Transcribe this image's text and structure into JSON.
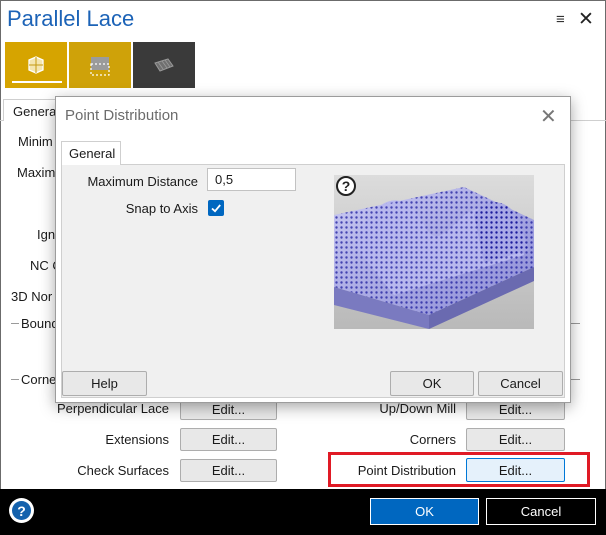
{
  "window": {
    "title": "Parallel Lace",
    "menu_glyph": "≡",
    "close_glyph": "✕"
  },
  "toolbar": {
    "tabs": [
      {
        "icon": "lace-surface-icon"
      },
      {
        "icon": "boundary-icon"
      },
      {
        "icon": "mesh-icon"
      }
    ]
  },
  "background": {
    "tab_label": "General",
    "labels": [
      "Minim",
      "Maxim",
      "Ign",
      "NC C",
      "3D Nor"
    ],
    "groups": [
      "Bound",
      "Corne"
    ],
    "rows_left": [
      {
        "label": "Perpendicular Lace",
        "button": "Edit..."
      },
      {
        "label": "Extensions",
        "button": "Edit..."
      },
      {
        "label": "Check Surfaces",
        "button": "Edit..."
      }
    ],
    "rows_right": [
      {
        "label": "Up/Down Mill",
        "button": "Edit..."
      },
      {
        "label": "Corners",
        "button": "Edit..."
      },
      {
        "label": "Point Distribution",
        "button": "Edit..."
      }
    ]
  },
  "dialog": {
    "title": "Point Distribution",
    "close_glyph": "✕",
    "tab_label": "General",
    "max_distance_label": "Maximum Distance",
    "max_distance_value": "0,5",
    "snap_label": "Snap to Axis",
    "snap_checked": true,
    "help_label": "Help",
    "ok_label": "OK",
    "cancel_label": "Cancel",
    "preview_help_glyph": "?"
  },
  "footer": {
    "help_glyph": "?",
    "ok_label": "OK",
    "cancel_label": "Cancel"
  },
  "colors": {
    "title_blue": "#1c63b7",
    "tab_gold": "#d6a400",
    "ok_blue": "#0067c0",
    "highlight_red": "#e01a25"
  }
}
